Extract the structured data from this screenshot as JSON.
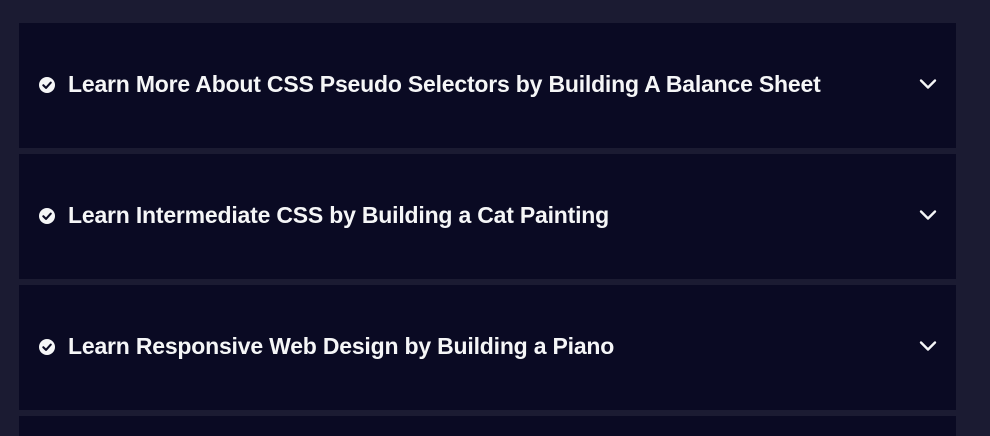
{
  "superblocks": [
    {
      "title": "Learn More About CSS Pseudo Selectors by Building A Balance Sheet",
      "completed_icon": "check-circle-icon",
      "expand_icon": "chevron-down-icon"
    },
    {
      "title": "Learn Intermediate CSS by Building a Cat Painting",
      "completed_icon": "check-circle-icon",
      "expand_icon": "chevron-down-icon"
    },
    {
      "title": "Learn Responsive Web Design by Building a Piano",
      "completed_icon": "check-circle-icon",
      "expand_icon": "chevron-down-icon"
    }
  ],
  "colors": {
    "page_background": "#1b1b32",
    "block_background": "#0a0a23",
    "text": "#f5f6f7"
  }
}
